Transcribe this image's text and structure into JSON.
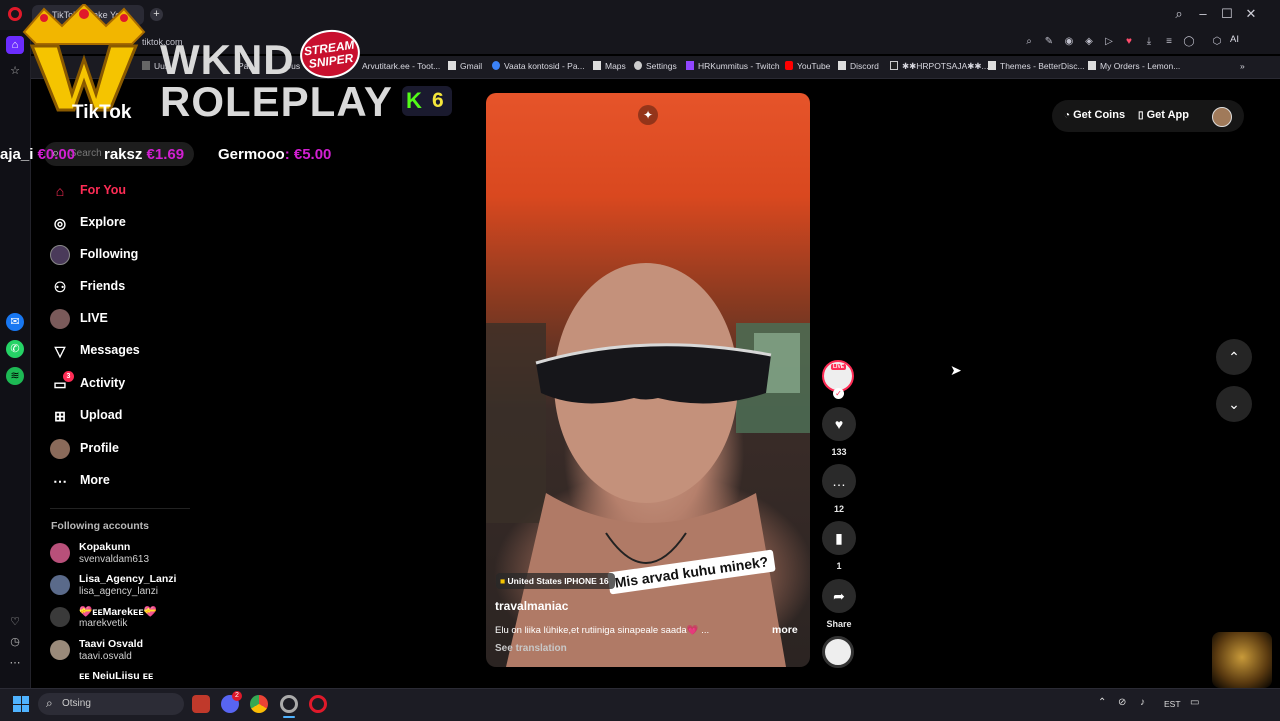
{
  "browser": {
    "tab_title": "TikTok - Make Your",
    "url": "tiktok.com",
    "bookmarks": [
      {
        "label": "Uus"
      },
      {
        "label": "Pa..."
      },
      {
        "label": "Uus"
      },
      {
        "label": "Arvutitark.ee - Toot..."
      },
      {
        "label": "Gmail"
      },
      {
        "label": "Vaata kontosid - Pa..."
      },
      {
        "label": "Maps"
      },
      {
        "label": "Settings"
      },
      {
        "label": "HRKummitus - Twitch"
      },
      {
        "label": "YouTube"
      },
      {
        "label": "Discord"
      },
      {
        "label": "✱✱HRPOTSAJA✱✱..."
      },
      {
        "label": "Themes - BetterDisc..."
      },
      {
        "label": "My Orders - Lemon..."
      }
    ],
    "ai_label": "AI"
  },
  "overlay": {
    "wknd": "WKND",
    "roleplay": "ROLEPLAY",
    "stream_sniper": "STREAM SNIPER",
    "k_number": "6",
    "tickers": [
      {
        "name": "aja_i",
        "amount": "€0.00"
      },
      {
        "name": "raksz",
        "amount": "€1.69"
      },
      {
        "name": "Germooo",
        "amount": "€5.00"
      }
    ]
  },
  "tiktok": {
    "logo": "TikTok",
    "search_placeholder": "Search",
    "nav": [
      {
        "label": "For You"
      },
      {
        "label": "Explore"
      },
      {
        "label": "Following"
      },
      {
        "label": "Friends"
      },
      {
        "label": "LIVE"
      },
      {
        "label": "Messages"
      },
      {
        "label": "Activity",
        "badge": "3"
      },
      {
        "label": "Upload"
      },
      {
        "label": "Profile"
      },
      {
        "label": "More"
      }
    ],
    "following_header": "Following accounts",
    "accounts": [
      {
        "name": "Kopakunn",
        "handle": "svenvaldam613"
      },
      {
        "name": "Lisa_Agency_Lanzi",
        "handle": "lisa_agency_lanzi"
      },
      {
        "name": "💝ᴇᴇMarekᴇᴇ💝",
        "handle": "marekvetik"
      },
      {
        "name": "Taavi Osvald",
        "handle": "taavi.osvald"
      },
      {
        "name": "ᴇᴇ NeiuLiisu ᴇᴇ",
        "handle": ""
      }
    ],
    "get_coins": "Get Coins",
    "get_app": "Get App",
    "video": {
      "location_tag": "United States IPHONE 16",
      "caption_overlay": "Mis arvad kuhu minek?",
      "author": "travalmaniac",
      "description": "Elu on liika lühike,et rutiiniga sinapeale saada💗 ...",
      "more": "more",
      "see_translation": "See translation"
    },
    "actions": {
      "live_badge": "LIVE",
      "likes": "133",
      "comments": "12",
      "saves": "1",
      "share": "Share"
    }
  },
  "taskbar": {
    "search_placeholder": "Otsing",
    "lang": "EST",
    "discord_badge": "2"
  }
}
